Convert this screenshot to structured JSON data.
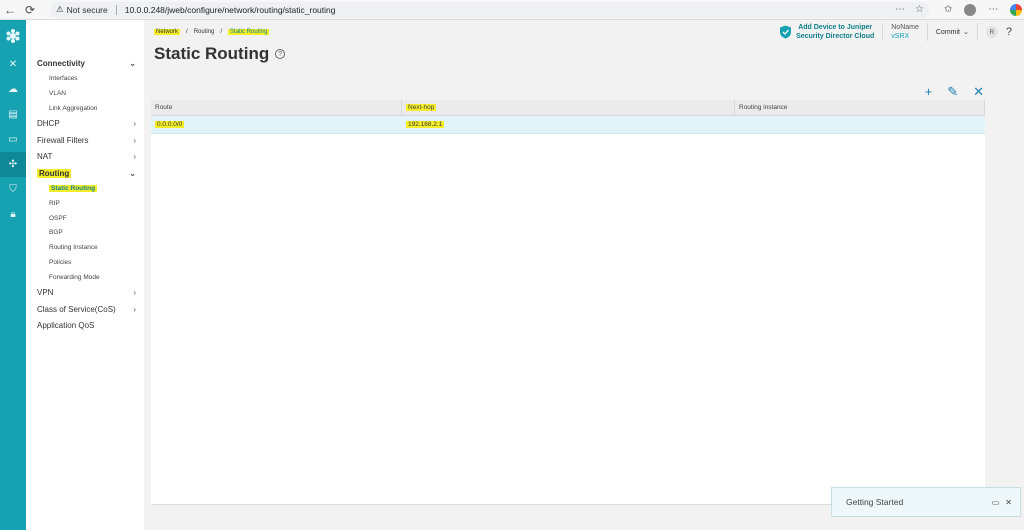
{
  "browser": {
    "security_label": "Not secure",
    "url": "10.0.0.248/jweb/configure/network/routing/static_routing"
  },
  "rail": {
    "items": [
      "close-icon",
      "dashboard-icon",
      "monitor-icon",
      "device-icon",
      "network-icon",
      "security-policy-icon",
      "lock-icon"
    ]
  },
  "sidebar": {
    "connectivity": "Connectivity",
    "interfaces": "Interfaces",
    "vlan": "VLAN",
    "link_aggregation": "Link Aggregation",
    "dhcp": "DHCP",
    "firewall_filters": "Firewall Filters",
    "nat": "NAT",
    "routing": "Routing",
    "static_routing": "Static Routing",
    "rip": "RIP",
    "ospf": "OSPF",
    "bgp": "BGP",
    "routing_instance": "Routing Instance",
    "policies": "Policies",
    "forwarding_mode": "Forwarding Mode",
    "vpn": "VPN",
    "cos": "Class of Service(CoS)",
    "application_qos": "Application QoS"
  },
  "breadcrumb": {
    "network": "Network",
    "sep1": "/",
    "routing": "Routing",
    "sep2": "/",
    "current": "Static Routing"
  },
  "page": {
    "title": "Static Routing",
    "help": "?"
  },
  "header": {
    "add_device_line1": "Add Device to Juniper",
    "add_device_line2": "Security Director Cloud",
    "device_name": "NoName",
    "device_type": "vSRX",
    "commit_label": "Commit",
    "user_initial": "R",
    "help": "?"
  },
  "toolbar": {
    "add": "+",
    "edit": "✎",
    "delete": "✕"
  },
  "grid": {
    "columns": [
      "Route",
      "Next-hop",
      "Routing instance"
    ],
    "rows": [
      {
        "route": "0.0.0.0/0",
        "next_hop": "192.168.2.1",
        "routing_instance": ""
      }
    ]
  },
  "getting_started": {
    "label": "Getting Started"
  },
  "colors": {
    "accent": "#17a2b1",
    "highlight": "#f4ee2a",
    "row_selected": "#e2f4fa"
  }
}
